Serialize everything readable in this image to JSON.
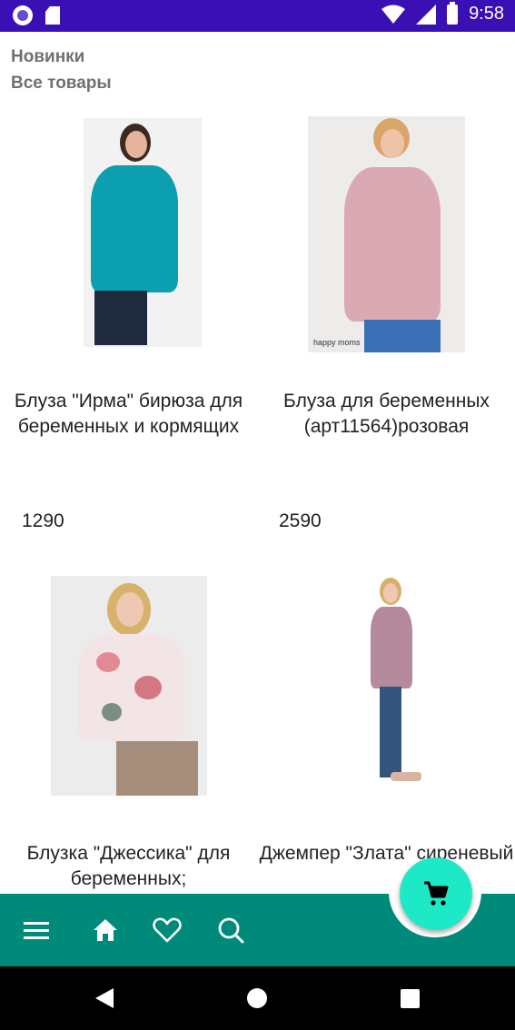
{
  "status_bar": {
    "time": "9:58",
    "icons": [
      "app-circle-icon",
      "sd-card-icon",
      "wifi-icon",
      "signal-icon",
      "battery-icon"
    ]
  },
  "header": {
    "link_new": "Новинки",
    "link_all": "Все товары"
  },
  "products": [
    {
      "title": "Блуза \"Ирма\" бирюза для беременных и кормящих",
      "price": "1290"
    },
    {
      "title": "Блуза для беременных (арт11564)розовая",
      "price": "2590"
    },
    {
      "title": "Блузка \"Джессика\" для беременных;",
      "price": ""
    },
    {
      "title": "Джемпер \"Злата\" сиреневый",
      "price": ""
    }
  ],
  "image_watermark": "happy moms",
  "bottom_nav": {
    "icons": [
      "menu-icon",
      "home-icon",
      "favorite-icon",
      "search-icon"
    ],
    "fab_icon": "cart-icon"
  },
  "colors": {
    "status_bar": "#3a0fb4",
    "bottom_bar": "#008a7a",
    "fab": "#1de9c6",
    "header_text": "#707070"
  }
}
